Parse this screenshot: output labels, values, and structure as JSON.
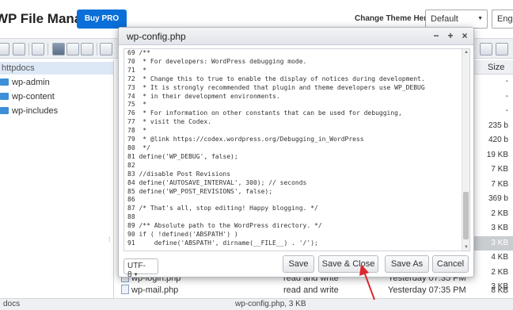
{
  "header": {
    "app_title": "WP File Manager",
    "buy_pro": "Buy PRO",
    "theme_label": "Change Theme Here:",
    "theme_value": "Default",
    "lang_value": "Engli"
  },
  "tree": {
    "root": "httpdocs",
    "items": [
      "wp-admin",
      "wp-content",
      "wp-includes"
    ]
  },
  "filelist": {
    "size_header": "Size",
    "sizes": [
      "-",
      "-",
      "-",
      "235 b",
      "420 b",
      "19 KB",
      "7 KB",
      "7 KB",
      "369 b",
      "2 KB",
      "3 KB",
      "3 KB",
      "4 KB",
      "2 KB",
      "3 KB",
      "38 KB"
    ],
    "partial_row": {
      "name": "wp-login.php",
      "perm": "read and write",
      "date": "Yesterday 07:35 PM",
      "size": "38 KB"
    },
    "last_row": {
      "name": "wp-mail.php",
      "perm": "read and write",
      "date": "Yesterday 07:35 PM",
      "size": "8 KB"
    }
  },
  "status": {
    "left": "docs",
    "center": "wp-config.php, 3 KB"
  },
  "dialog": {
    "title": "wp-config.php",
    "minimize": "−",
    "maximize": "+",
    "close": "×",
    "code_lines": [
      "69 /**",
      "70  * For developers: WordPress debugging mode.",
      "71  *",
      "72  * Change this to true to enable the display of notices during development.",
      "73  * It is strongly recommended that plugin and theme developers use WP_DEBUG",
      "74  * in their development environments.",
      "75  *",
      "76  * For information on other constants that can be used for debugging,",
      "77  * visit the Codex.",
      "78  *",
      "79  * @link https://codex.wordpress.org/Debugging_in_WordPress",
      "80  */",
      "81 define('WP_DEBUG', false);",
      "82",
      "83 //disable Post Revisions",
      "84 define('AUTOSAVE_INTERVAL', 300); // seconds",
      "85 define('WP_POST_REVISIONS', false);",
      "86",
      "87 /* That's all, stop editing! Happy blogging. */",
      "88",
      "89 /** Absolute path to the WordPress directory. */",
      "90 if ( !defined('ABSPATH') )",
      "91     define('ABSPATH', dirname(__FILE__) . '/');"
    ],
    "encoding": "UTF-8",
    "buttons": {
      "save": "Save",
      "save_close": "Save & Close",
      "save_as": "Save As",
      "cancel": "Cancel"
    }
  },
  "colors": {
    "accent": "#0a6fd8",
    "annotation": "#d9292e",
    "selection": "#c9ccd1"
  }
}
